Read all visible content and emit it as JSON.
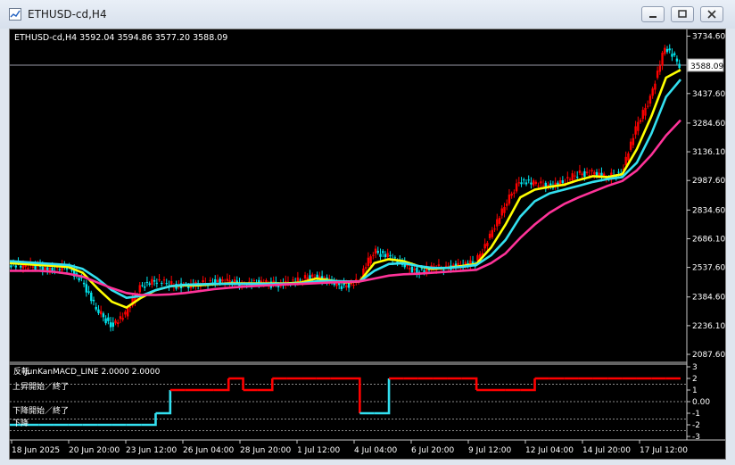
{
  "window": {
    "title": "ETHUSD-cd,H4",
    "icon": "chart-window-icon",
    "controls": [
      "minimize-icon",
      "restore-icon",
      "close-icon"
    ]
  },
  "chart": {
    "info_label": "ETHUSD-cd,H4  3592.04 3594.86 3577.20 3588.09",
    "current_price_label": "3588.09",
    "colors": {
      "background": "#000000",
      "bull_candle": "#ff0000",
      "bear_candle": "#00e5ee",
      "ma_fast": "#ffff00",
      "ma_mid": "#33e0f0",
      "ma_slow": "#ff3399",
      "indicator_up": "#ff0000",
      "indicator_down": "#33e0f0"
    }
  },
  "indicator": {
    "label": "JunKanMACD_LINE 2.0000 2.0000",
    "label_prefix": "反転",
    "levels": [
      {
        "text": "上昇開始／終了",
        "value": 1.5
      },
      {
        "text": "下降開始／終了",
        "value": -1.5
      },
      {
        "text": "下降",
        "value": -2.5
      }
    ],
    "axis_labels": [
      "3",
      "2",
      "1",
      "0.00",
      "-1",
      "-2",
      "-3"
    ]
  },
  "chart_data": [
    {
      "type": "line",
      "title": "ETHUSD-cd,H4",
      "y_ticks": [
        "3734.60",
        "3588.09",
        "3437.60",
        "3284.60",
        "3136.10",
        "2987.60",
        "2834.60",
        "2686.10",
        "2537.60",
        "2384.60",
        "2236.10",
        "2087.60"
      ],
      "x_ticks": [
        "18 Jun 2025",
        "20 Jun 20:00",
        "23 Jun 12:00",
        "26 Jun 04:00",
        "28 Jun 20:00",
        "1 Jul 12:00",
        "4 Jul 04:00",
        "6 Jul 20:00",
        "9 Jul 12:00",
        "12 Jul 04:00",
        "14 Jul 20:00",
        "17 Jul 12:00"
      ],
      "ylim": [
        2060,
        3760
      ],
      "x": [
        0,
        4,
        8,
        12,
        16,
        20,
        24,
        28,
        32,
        36,
        40,
        44,
        48,
        52,
        56,
        60,
        64,
        68,
        72,
        76,
        80,
        84,
        88,
        92,
        96,
        100,
        104,
        108,
        112,
        116,
        120,
        124,
        128,
        132,
        136,
        140,
        144,
        148,
        152,
        156,
        160,
        164,
        168,
        172,
        176,
        180,
        184
      ],
      "series": [
        {
          "values": [
            2560,
            2540,
            2545,
            2520,
            2545,
            2470,
            2320,
            2240,
            2290,
            2440,
            2470,
            2450,
            2440,
            2445,
            2470,
            2460,
            2455,
            2460,
            2450,
            2455,
            2470,
            2500,
            2460,
            2440,
            2470,
            2620,
            2600,
            2550,
            2520,
            2530,
            2540,
            2550,
            2560,
            2700,
            2850,
            2990,
            2970,
            2960,
            2980,
            3020,
            3030,
            3000,
            3030,
            3250,
            3420,
            3680,
            3588
          ]
        },
        {
          "values": [
            2560,
            2555,
            2550,
            2545,
            2540,
            2510,
            2430,
            2360,
            2330,
            2380,
            2420,
            2440,
            2445,
            2445,
            2450,
            2455,
            2455,
            2455,
            2455,
            2455,
            2460,
            2480,
            2470,
            2460,
            2465,
            2560,
            2580,
            2570,
            2545,
            2530,
            2535,
            2545,
            2555,
            2640,
            2760,
            2900,
            2940,
            2955,
            2965,
            2990,
            3010,
            3005,
            3020,
            3150,
            3320,
            3520,
            3560
          ]
        },
        {
          "values": [
            2570,
            2565,
            2560,
            2555,
            2550,
            2530,
            2480,
            2420,
            2380,
            2390,
            2420,
            2440,
            2448,
            2450,
            2452,
            2452,
            2452,
            2452,
            2452,
            2452,
            2455,
            2465,
            2468,
            2465,
            2465,
            2520,
            2555,
            2560,
            2545,
            2535,
            2535,
            2540,
            2550,
            2600,
            2680,
            2800,
            2880,
            2920,
            2940,
            2960,
            2980,
            2995,
            3005,
            3080,
            3230,
            3420,
            3510
          ]
        },
        {
          "values": [
            2520,
            2520,
            2520,
            2515,
            2505,
            2490,
            2460,
            2430,
            2405,
            2395,
            2395,
            2398,
            2405,
            2415,
            2425,
            2432,
            2438,
            2442,
            2446,
            2450,
            2452,
            2456,
            2460,
            2462,
            2465,
            2480,
            2495,
            2502,
            2505,
            2510,
            2515,
            2520,
            2525,
            2560,
            2610,
            2690,
            2760,
            2820,
            2865,
            2900,
            2930,
            2960,
            2985,
            3040,
            3120,
            3220,
            3300
          ]
        }
      ]
    },
    {
      "type": "line",
      "title": "JunKanMACD_LINE 2.0000 2.0000",
      "ylim": [
        -3,
        3
      ],
      "y_ticks": [
        "3",
        "2",
        "1",
        "0.00",
        "-1",
        "-2",
        "-3"
      ],
      "x": [
        0,
        4,
        8,
        12,
        16,
        20,
        24,
        28,
        32,
        36,
        40,
        44,
        48,
        52,
        56,
        60,
        64,
        68,
        72,
        76,
        80,
        84,
        88,
        92,
        96,
        100,
        104,
        108,
        112,
        116,
        120,
        124,
        128,
        132,
        136,
        140,
        144,
        148,
        152,
        156,
        160,
        164,
        168,
        172,
        176,
        180,
        184
      ],
      "series": [
        {
          "values": [
            -2,
            -2,
            -2,
            -2,
            -2,
            -2,
            -2,
            -2,
            -2,
            -2,
            -1,
            1,
            1,
            1,
            1,
            2,
            1,
            1,
            2,
            2,
            2,
            2,
            2,
            2,
            -1,
            -1,
            2,
            2,
            2,
            2,
            2,
            2,
            1,
            1,
            1,
            1,
            2,
            2,
            2,
            2,
            2,
            2,
            2,
            2,
            2,
            2,
            2,
            2
          ]
        }
      ]
    }
  ]
}
